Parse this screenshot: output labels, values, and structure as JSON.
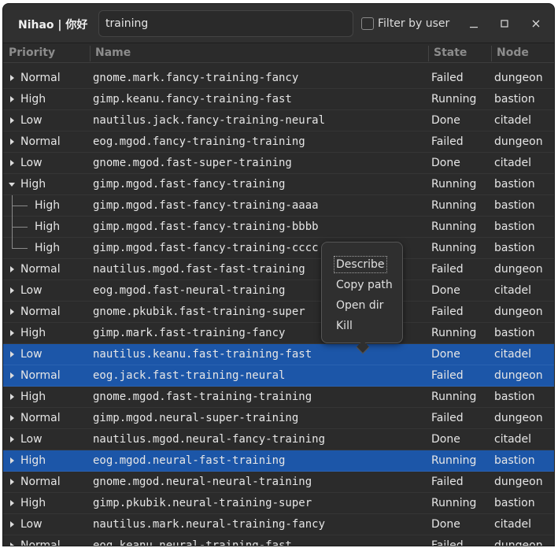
{
  "window": {
    "title": "Nihao | 你好",
    "search_value": "training",
    "filter_label": "Filter by user",
    "filter_checked": false
  },
  "columns": [
    "Priority",
    "Name",
    "State",
    "Node"
  ],
  "colors": {
    "selected_bg": "#1c56a8",
    "window_bg": "#2b2b2b",
    "text": "#e6e6e6"
  },
  "rows": [
    {
      "priority": "Normal",
      "name": "gnome.mark.fancy-training-fancy",
      "state": "Failed",
      "node": "dungeon",
      "expander": "collapsed",
      "selected": false
    },
    {
      "priority": "High",
      "name": "gimp.keanu.fancy-training-fast",
      "state": "Running",
      "node": "bastion",
      "expander": "collapsed",
      "selected": false
    },
    {
      "priority": "Low",
      "name": "nautilus.jack.fancy-training-neural",
      "state": "Done",
      "node": "citadel",
      "expander": "collapsed",
      "selected": false
    },
    {
      "priority": "Normal",
      "name": "eog.mgod.fancy-training-training",
      "state": "Failed",
      "node": "dungeon",
      "expander": "collapsed",
      "selected": false
    },
    {
      "priority": "Low",
      "name": "gnome.mgod.fast-super-training",
      "state": "Done",
      "node": "citadel",
      "expander": "collapsed",
      "selected": false
    },
    {
      "priority": "High",
      "name": "gimp.mgod.fast-fancy-training",
      "state": "Running",
      "node": "bastion",
      "expander": "expanded",
      "selected": false
    },
    {
      "priority": "High",
      "name": "gimp.mgod.fast-fancy-training-aaaa",
      "state": "Running",
      "node": "bastion",
      "expander": "child",
      "selected": false
    },
    {
      "priority": "High",
      "name": "gimp.mgod.fast-fancy-training-bbbb",
      "state": "Running",
      "node": "bastion",
      "expander": "child",
      "selected": false
    },
    {
      "priority": "High",
      "name": "gimp.mgod.fast-fancy-training-cccc",
      "state": "Running",
      "node": "bastion",
      "expander": "child-last",
      "selected": false
    },
    {
      "priority": "Normal",
      "name": "nautilus.mgod.fast-fast-training",
      "state": "Failed",
      "node": "dungeon",
      "expander": "collapsed",
      "selected": false
    },
    {
      "priority": "Low",
      "name": "eog.mgod.fast-neural-training",
      "state": "Done",
      "node": "citadel",
      "expander": "collapsed",
      "selected": false
    },
    {
      "priority": "Normal",
      "name": "gnome.pkubik.fast-training-super",
      "state": "Failed",
      "node": "dungeon",
      "expander": "collapsed",
      "selected": false
    },
    {
      "priority": "High",
      "name": "gimp.mark.fast-training-fancy",
      "state": "Running",
      "node": "bastion",
      "expander": "collapsed",
      "selected": false
    },
    {
      "priority": "Low",
      "name": "nautilus.keanu.fast-training-fast",
      "state": "Done",
      "node": "citadel",
      "expander": "collapsed",
      "selected": true
    },
    {
      "priority": "Normal",
      "name": "eog.jack.fast-training-neural",
      "state": "Failed",
      "node": "dungeon",
      "expander": "collapsed",
      "selected": true
    },
    {
      "priority": "High",
      "name": "gnome.mgod.fast-training-training",
      "state": "Running",
      "node": "bastion",
      "expander": "collapsed",
      "selected": false
    },
    {
      "priority": "Normal",
      "name": "gimp.mgod.neural-super-training",
      "state": "Failed",
      "node": "dungeon",
      "expander": "collapsed",
      "selected": false
    },
    {
      "priority": "Low",
      "name": "nautilus.mgod.neural-fancy-training",
      "state": "Done",
      "node": "citadel",
      "expander": "collapsed",
      "selected": false
    },
    {
      "priority": "High",
      "name": "eog.mgod.neural-fast-training",
      "state": "Running",
      "node": "bastion",
      "expander": "collapsed",
      "selected": true
    },
    {
      "priority": "Normal",
      "name": "gnome.mgod.neural-neural-training",
      "state": "Failed",
      "node": "dungeon",
      "expander": "collapsed",
      "selected": false
    },
    {
      "priority": "High",
      "name": "gimp.pkubik.neural-training-super",
      "state": "Running",
      "node": "bastion",
      "expander": "collapsed",
      "selected": false
    },
    {
      "priority": "Low",
      "name": "nautilus.mark.neural-training-fancy",
      "state": "Done",
      "node": "citadel",
      "expander": "collapsed",
      "selected": false
    },
    {
      "priority": "Normal",
      "name": "eog.keanu.neural-training-fast",
      "state": "Failed",
      "node": "dungeon",
      "expander": "collapsed",
      "selected": false
    }
  ],
  "context_menu": {
    "items": [
      "Describe",
      "Copy path",
      "Open dir",
      "Kill"
    ],
    "focused_index": 0
  }
}
